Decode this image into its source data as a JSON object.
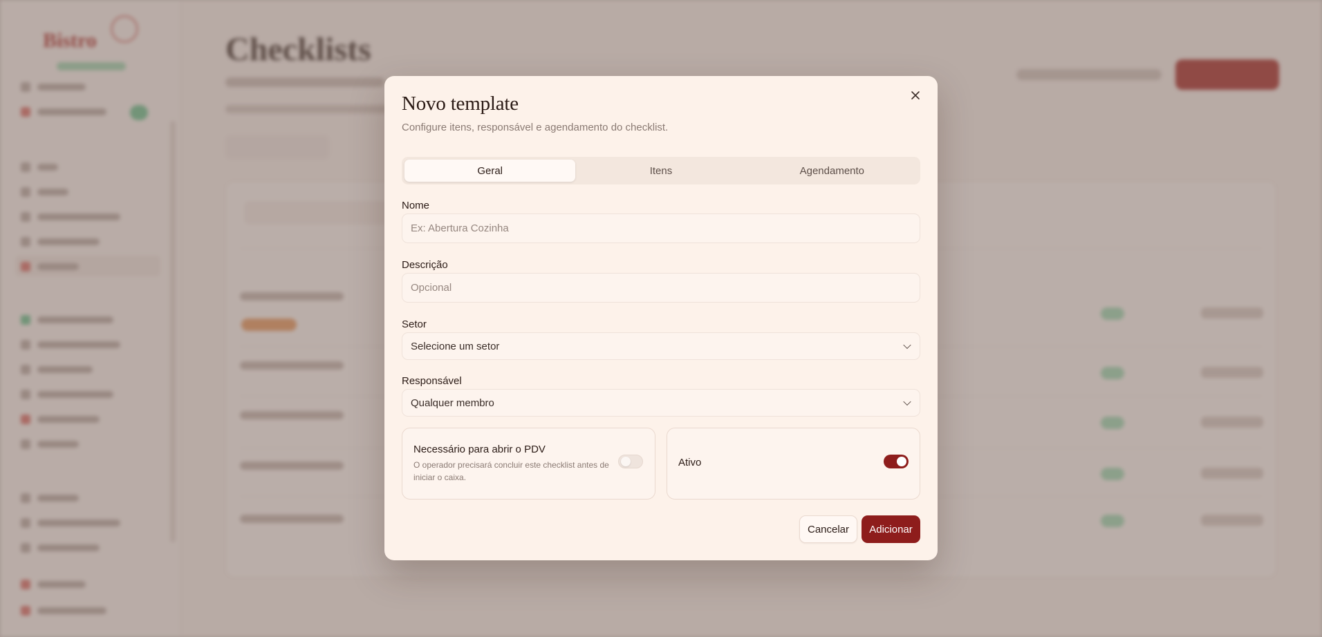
{
  "background": {
    "page_title": "Checklists"
  },
  "modal": {
    "title": "Novo template",
    "description": "Configure itens, responsável e agendamento do checklist.",
    "close_icon": "close-icon",
    "tabs": [
      {
        "label": "Geral",
        "active": true
      },
      {
        "label": "Itens",
        "active": false
      },
      {
        "label": "Agendamento",
        "active": false
      }
    ],
    "fields": {
      "nome": {
        "label": "Nome",
        "value": "",
        "placeholder": "Ex: Abertura Cozinha"
      },
      "descricao": {
        "label": "Descrição",
        "value": "",
        "placeholder": "Opcional"
      },
      "setor": {
        "label": "Setor",
        "selected": "Selecione um setor"
      },
      "responsavel": {
        "label": "Responsável",
        "selected": "Qualquer membro"
      }
    },
    "options": {
      "pdv": {
        "title": "Necessário para abrir o PDV",
        "description": "O operador precisará concluir este checklist antes de iniciar o caixa.",
        "enabled": false
      },
      "ativo": {
        "title": "Ativo",
        "enabled": true
      }
    },
    "buttons": {
      "cancel": "Cancelar",
      "submit": "Adicionar"
    },
    "colors": {
      "accent": "#8e1d1c",
      "surface": "#fdf2ea"
    }
  }
}
